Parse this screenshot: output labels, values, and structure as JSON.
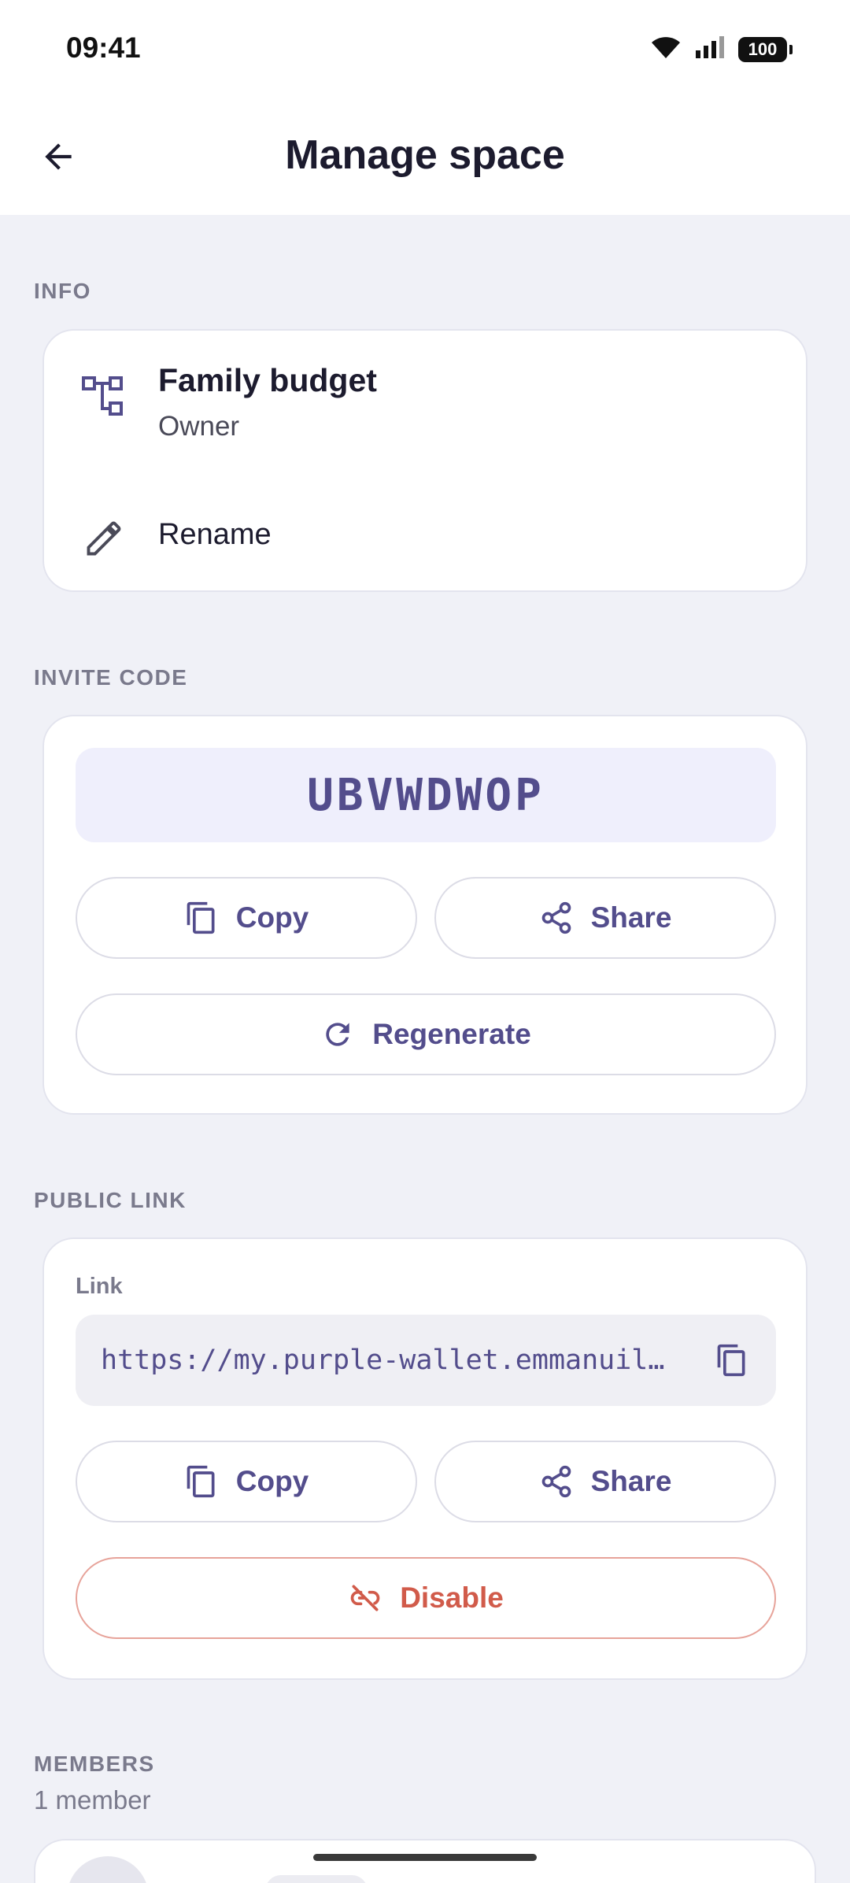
{
  "status_bar": {
    "time": "09:41",
    "battery": "100"
  },
  "app_bar": {
    "title": "Manage space"
  },
  "info": {
    "section_label": "INFO",
    "space_name": "Family budget",
    "role": "Owner",
    "rename_label": "Rename"
  },
  "invite": {
    "section_label": "INVITE CODE",
    "code": "UBVWDWOP",
    "copy_label": "Copy",
    "share_label": "Share",
    "regenerate_label": "Regenerate"
  },
  "public_link": {
    "section_label": "PUBLIC LINK",
    "field_label": "Link",
    "url": "https://my.purple-wallet.emmanuil…",
    "copy_label": "Copy",
    "share_label": "Share",
    "disable_label": "Disable"
  },
  "members": {
    "section_label": "MEMBERS",
    "count_label": "1 member"
  },
  "colors": {
    "accent": "#534d8c",
    "danger": "#d15b4a",
    "background": "#f0f1f7",
    "code_background": "#efeffc"
  },
  "icons": [
    "back-arrow-icon",
    "wifi-icon",
    "signal-icon",
    "battery-icon",
    "space-icon",
    "pencil-icon",
    "copy-icon",
    "share-icon",
    "refresh-icon",
    "link-off-icon"
  ]
}
